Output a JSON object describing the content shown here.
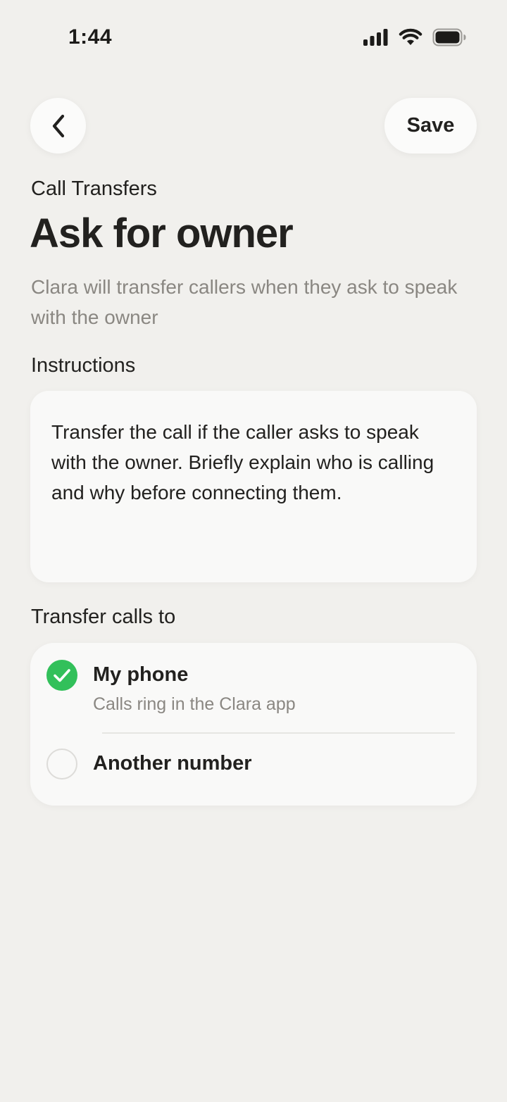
{
  "status_bar": {
    "time": "1:44",
    "icons": [
      "cellular-signal-icon",
      "wifi-icon",
      "battery-icon"
    ]
  },
  "nav": {
    "back_icon": "chevron-left-icon",
    "save_label": "Save"
  },
  "header": {
    "section": "Call Transfers",
    "title": "Ask for owner",
    "subtitle": "Clara will transfer callers when they ask to speak with the owner"
  },
  "instructions": {
    "label": "Instructions",
    "text": "Transfer the call if the caller asks to speak with the owner. Briefly explain who is calling and why before connecting them."
  },
  "transfer": {
    "label": "Transfer calls to",
    "options": [
      {
        "title": "My phone",
        "description": "Calls ring in the Clara app",
        "selected": true
      },
      {
        "title": "Another number",
        "selected": false
      }
    ]
  },
  "colors": {
    "background": "#f1f0ed",
    "card": "#f9f9f8",
    "accent_green": "#32c05a",
    "text_primary": "#22211f",
    "text_secondary": "#8a8782"
  }
}
